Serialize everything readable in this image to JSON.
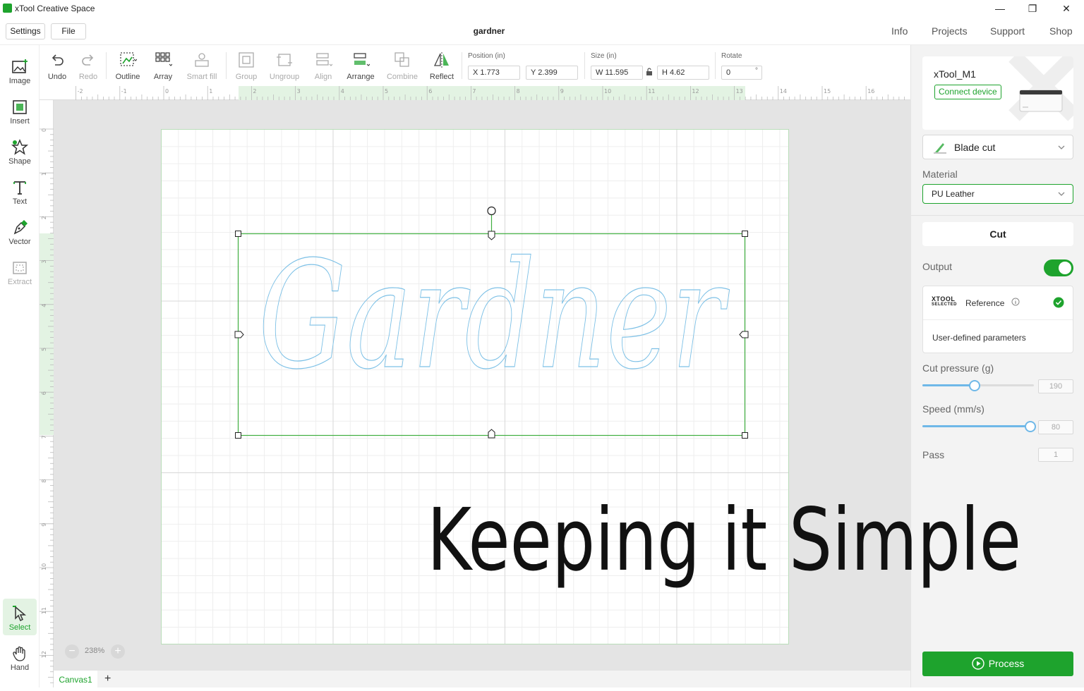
{
  "app": {
    "title": "xTool Creative Space"
  },
  "window_controls": {
    "minimize": "—",
    "restore": "❐",
    "close": "✕"
  },
  "menu": {
    "settings": "Settings",
    "file": "File",
    "doc_title": "gardner"
  },
  "top_links": [
    "Info",
    "Projects",
    "Support",
    "Shop"
  ],
  "left_tools": [
    {
      "label": "Image",
      "icon": "image-plus-icon"
    },
    {
      "label": "Insert",
      "icon": "insert-icon"
    },
    {
      "label": "Shape",
      "icon": "star-shape-icon"
    },
    {
      "label": "Text",
      "icon": "text-icon"
    },
    {
      "label": "Vector",
      "icon": "pen-icon"
    },
    {
      "label": "Extract",
      "icon": "extract-icon"
    },
    {
      "label": "Select",
      "icon": "cursor-icon"
    },
    {
      "label": "Hand",
      "icon": "hand-icon"
    }
  ],
  "toolbar": {
    "undo": "Undo",
    "redo": "Redo",
    "outline": "Outline",
    "array": "Array",
    "smart_fill": "Smart fill",
    "group": "Group",
    "ungroup": "Ungroup",
    "align": "Align",
    "arrange": "Arrange",
    "combine": "Combine",
    "reflect": "Reflect",
    "position_label": "Position (in)",
    "x": "X 1.773",
    "y": "Y 2.399",
    "size_label": "Size (in)",
    "w": "W 11.595",
    "h": "H 4.62",
    "rotate_label": "Rotate",
    "rotate": "0",
    "rotate_unit": "°"
  },
  "rulers": {
    "top": [
      "-2",
      "-1",
      "0",
      "1",
      "2",
      "3",
      "4",
      "5",
      "6",
      "7",
      "8",
      "9",
      "10",
      "11",
      "12",
      "13",
      "14",
      "15",
      "16"
    ],
    "left": [
      "0",
      "1",
      "2",
      "3",
      "4",
      "5",
      "6",
      "7",
      "8",
      "9",
      "10",
      "11",
      "12"
    ]
  },
  "canvas": {
    "design_text": "Gardner",
    "zoom": "238%",
    "tab": "Canvas1",
    "add_tab": "+"
  },
  "overlay_text": "Keeping it Simple",
  "panel": {
    "device_name": "xTool_M1",
    "connect": "Connect device",
    "mode": "Blade cut",
    "material_label": "Material",
    "material": "PU Leather",
    "cut_tab": "Cut",
    "output_label": "Output",
    "output_on": true,
    "xtool_logo_top": "XTOOL",
    "xtool_logo_bottom": "SELECTED",
    "reference": "Reference",
    "user_defined": "User-defined parameters",
    "cut_pressure_label": "Cut pressure (g)",
    "cut_pressure": "190",
    "cut_pressure_fraction": 0.47,
    "speed_label": "Speed (mm/s)",
    "speed": "80",
    "speed_fraction": 0.97,
    "pass_label": "Pass",
    "pass": "1",
    "process": "Process"
  },
  "colors": {
    "accent": "#1ea32d",
    "path": "#7cc0e6",
    "selection": "#3fae3f"
  }
}
